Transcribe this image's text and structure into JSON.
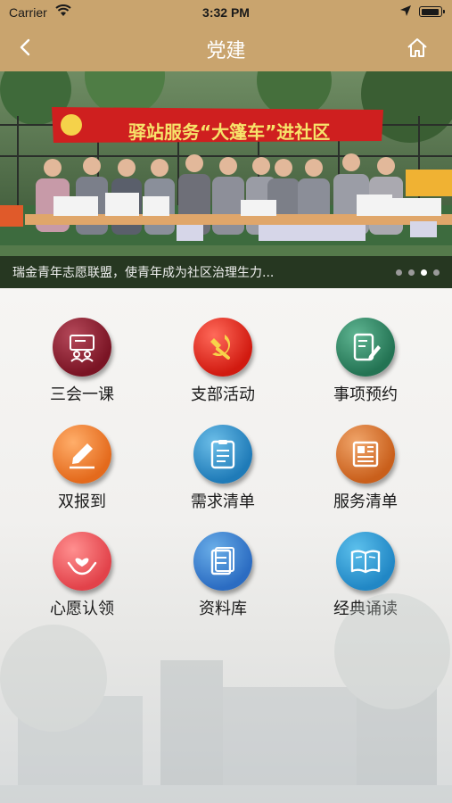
{
  "status_bar": {
    "carrier": "Carrier",
    "time": "3:32 PM"
  },
  "nav": {
    "title": "党建",
    "back_icon": "chevron-left-icon",
    "home_icon": "home-icon"
  },
  "banner": {
    "caption": "瑞金青年志愿联盟，使青年成为社区治理生力...",
    "banner_text": "驿站服务“大篷车”进社区",
    "slide_count": 4,
    "active_slide": 3
  },
  "menu": [
    {
      "label": "三会一课",
      "icon": "meeting-board-icon",
      "color": "#8b1d2c"
    },
    {
      "label": "支部活动",
      "icon": "party-emblem-icon",
      "color": "#e0221a"
    },
    {
      "label": "事项预约",
      "icon": "edit-document-icon",
      "color": "#2f8a63"
    },
    {
      "label": "双报到",
      "icon": "pen-sign-icon",
      "color": "#ee7a2a"
    },
    {
      "label": "需求清单",
      "icon": "clipboard-list-icon",
      "color": "#2a8bc7"
    },
    {
      "label": "服务清单",
      "icon": "newspaper-icon",
      "color": "#d86c24"
    },
    {
      "label": "心愿认领",
      "icon": "heart-hands-icon",
      "color": "#ea5158"
    },
    {
      "label": "资料库",
      "icon": "books-icon",
      "color": "#3478cc"
    },
    {
      "label": "经典诵读",
      "icon": "open-book-icon",
      "color": "#2b93d0"
    }
  ]
}
